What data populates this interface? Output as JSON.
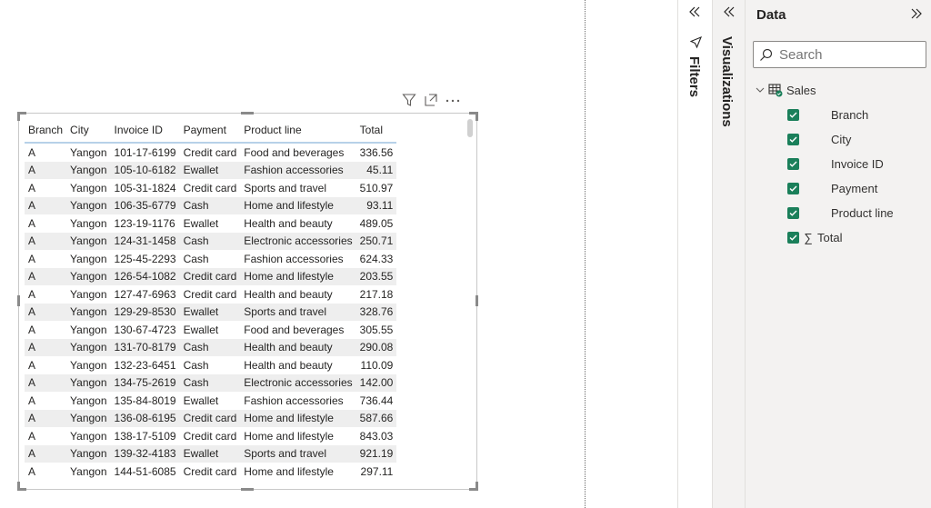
{
  "table": {
    "columns": [
      "Branch",
      "City",
      "Invoice ID",
      "Payment",
      "Product line",
      "Total"
    ],
    "rows": [
      [
        "A",
        "Yangon",
        "101-17-6199",
        "Credit card",
        "Food and beverages",
        "336.56"
      ],
      [
        "A",
        "Yangon",
        "105-10-6182",
        "Ewallet",
        "Fashion accessories",
        "45.11"
      ],
      [
        "A",
        "Yangon",
        "105-31-1824",
        "Credit card",
        "Sports and travel",
        "510.97"
      ],
      [
        "A",
        "Yangon",
        "106-35-6779",
        "Cash",
        "Home and lifestyle",
        "93.11"
      ],
      [
        "A",
        "Yangon",
        "123-19-1176",
        "Ewallet",
        "Health and beauty",
        "489.05"
      ],
      [
        "A",
        "Yangon",
        "124-31-1458",
        "Cash",
        "Electronic accessories",
        "250.71"
      ],
      [
        "A",
        "Yangon",
        "125-45-2293",
        "Cash",
        "Fashion accessories",
        "624.33"
      ],
      [
        "A",
        "Yangon",
        "126-54-1082",
        "Credit card",
        "Home and lifestyle",
        "203.55"
      ],
      [
        "A",
        "Yangon",
        "127-47-6963",
        "Credit card",
        "Health and beauty",
        "217.18"
      ],
      [
        "A",
        "Yangon",
        "129-29-8530",
        "Ewallet",
        "Sports and travel",
        "328.76"
      ],
      [
        "A",
        "Yangon",
        "130-67-4723",
        "Ewallet",
        "Food and beverages",
        "305.55"
      ],
      [
        "A",
        "Yangon",
        "131-70-8179",
        "Cash",
        "Health and beauty",
        "290.08"
      ],
      [
        "A",
        "Yangon",
        "132-23-6451",
        "Cash",
        "Health and beauty",
        "110.09"
      ],
      [
        "A",
        "Yangon",
        "134-75-2619",
        "Cash",
        "Electronic accessories",
        "142.00"
      ],
      [
        "A",
        "Yangon",
        "135-84-8019",
        "Ewallet",
        "Fashion accessories",
        "736.44"
      ],
      [
        "A",
        "Yangon",
        "136-08-6195",
        "Credit card",
        "Home and lifestyle",
        "587.66"
      ],
      [
        "A",
        "Yangon",
        "138-17-5109",
        "Credit card",
        "Home and lifestyle",
        "843.03"
      ],
      [
        "A",
        "Yangon",
        "139-32-4183",
        "Ewallet",
        "Sports and travel",
        "921.19"
      ],
      [
        "A",
        "Yangon",
        "144-51-6085",
        "Credit card",
        "Home and lifestyle",
        "297.11"
      ]
    ]
  },
  "panes": {
    "filters_label": "Filters",
    "visualizations_label": "Visualizations",
    "data_title": "Data",
    "search_placeholder": "Search",
    "table_name": "Sales",
    "fields": [
      "Branch",
      "City",
      "Invoice ID",
      "Payment",
      "Product line",
      "Total"
    ],
    "sigma": "∑"
  },
  "icons": {
    "filter": "filter-icon",
    "focus_mode": "focus-mode-icon",
    "more_options": "more-options-icon",
    "collapse": "double-chevron-left-icon",
    "expand": "double-chevron-right-icon",
    "search": "search-icon",
    "table": "table-icon"
  },
  "colors": {
    "checkbox": "#1a7f5a",
    "pane_bg": "#f3f2f1",
    "header_rule": "#b7d1e8",
    "row_alt": "#eeeeee"
  }
}
